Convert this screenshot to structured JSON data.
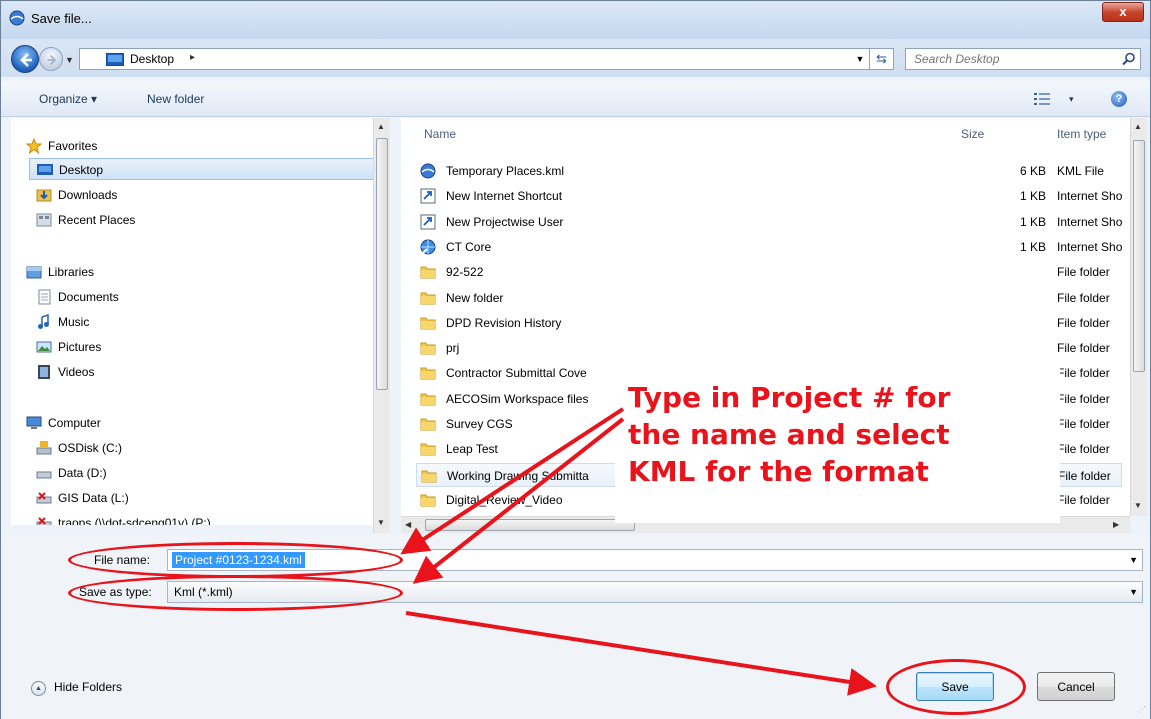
{
  "window": {
    "title": "Save file...",
    "close_label": "x"
  },
  "address": {
    "location": "Desktop",
    "separator": "▸",
    "search_placeholder": "Search Desktop"
  },
  "toolbar": {
    "organize_label": "Organize ▾",
    "new_folder_label": "New folder",
    "views_arrow": "▾",
    "help_label": "?"
  },
  "nav": {
    "favorites": "Favorites",
    "desktop": "Desktop",
    "downloads": "Downloads",
    "recent": "Recent Places",
    "libraries": "Libraries",
    "documents": "Documents",
    "music": "Music",
    "pictures": "Pictures",
    "videos": "Videos",
    "computer": "Computer",
    "osdisk": "OSDisk (C:)",
    "data": "Data (D:)",
    "gis": "GIS Data (L:)",
    "traops": "traops (\\\\dot-sdceng01v) (P:)"
  },
  "files": {
    "columns": {
      "name": "Name",
      "size": "Size",
      "type": "Item type"
    },
    "rows": [
      {
        "name": "Temporary Places.kml",
        "size": "6 KB",
        "type": "KML File",
        "icon": "earth-icon"
      },
      {
        "name": "New Internet Shortcut",
        "size": "1 KB",
        "type": "Internet Sho",
        "icon": "shortcut-icon"
      },
      {
        "name": "New Projectwise User",
        "size": "1 KB",
        "type": "Internet Sho",
        "icon": "shortcut-icon"
      },
      {
        "name": "CT Core",
        "size": "1 KB",
        "type": "Internet Sho",
        "icon": "globe-shortcut-icon"
      },
      {
        "name": "92-522",
        "size": "",
        "type": "File folder",
        "icon": "folder-icon"
      },
      {
        "name": "New folder",
        "size": "",
        "type": "File folder",
        "icon": "folder-icon"
      },
      {
        "name": "DPD Revision History",
        "size": "",
        "type": "File folder",
        "icon": "folder-icon"
      },
      {
        "name": "prj",
        "size": "",
        "type": "File folder",
        "icon": "folder-icon"
      },
      {
        "name": "Contractor Submittal Cove",
        "size": "",
        "type": "File folder",
        "icon": "folder-icon"
      },
      {
        "name": "AECOSim Workspace files",
        "size": "",
        "type": "File folder",
        "icon": "folder-icon"
      },
      {
        "name": "Survey CGS",
        "size": "",
        "type": "File folder",
        "icon": "folder-icon"
      },
      {
        "name": "Leap Test",
        "size": "",
        "type": "File folder",
        "icon": "folder-icon"
      },
      {
        "name": "Working Drawing Submitta",
        "size": "",
        "type": "File folder",
        "icon": "folder-icon"
      },
      {
        "name": "Digital_Review_Video",
        "size": "",
        "type": "File folder",
        "icon": "folder-icon"
      }
    ]
  },
  "annotation": {
    "text": "Type in Project # for\nthe name and select\nKML for the format",
    "color": "#e8131b"
  },
  "form": {
    "filename_label": "File name:",
    "filename_value": "Project #0123-1234.kml",
    "savetype_label": "Save as type:",
    "savetype_value": "Kml (*.kml)"
  },
  "footer": {
    "hide_folders_label": "Hide Folders",
    "save_label": "Save",
    "cancel_label": "Cancel"
  }
}
